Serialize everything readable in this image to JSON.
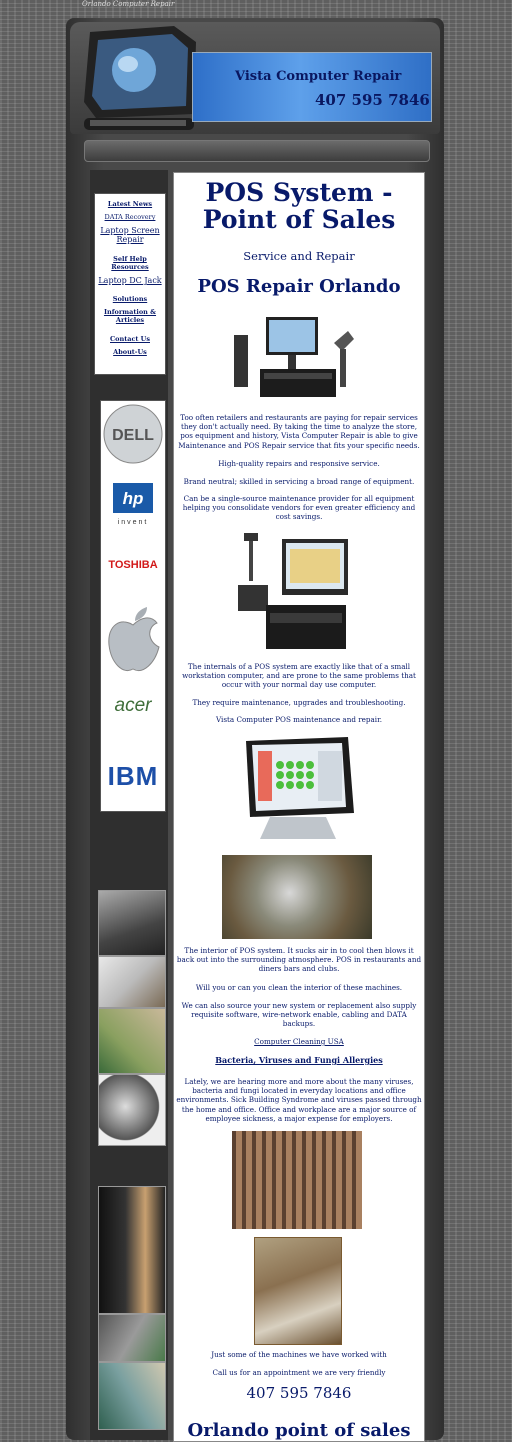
{
  "page": {
    "caption": "Orlando Computer Repair"
  },
  "banner": {
    "title": "Vista Computer Repair",
    "phone": "407 595 7846"
  },
  "nav": {
    "items": [
      {
        "label": "Latest News"
      },
      {
        "label": "DATA Recovery"
      },
      {
        "label": "Laptop Screen Repair"
      },
      {
        "label": "Self Help Resources"
      },
      {
        "label": "Laptop DC Jack"
      },
      {
        "label": "Solutions"
      },
      {
        "label": "Information & Articles"
      },
      {
        "label": "Contact Us"
      },
      {
        "label": "About-Us"
      }
    ]
  },
  "brands": {
    "dell": "DELL",
    "hp": "hp",
    "hp_sub": "invent",
    "toshiba": "TOSHIBA",
    "acer": "acer",
    "ibm": "IBM"
  },
  "content": {
    "title": "POS System - Point of Sales",
    "subtitle": "Service and Repair",
    "heading": "POS Repair Orlando",
    "p1": "Too often retailers and restaurants are paying for repair services they don't actually need. By taking the time to analyze the store, pos equipment and history, Vista Computer Repair is able to give Maintenance and POS Repair service that fits your specific needs.",
    "p2": "High-quality repairs and responsive service.",
    "p3": "Brand neutral; skilled in servicing a broad range of equipment.",
    "p4": "Can be a single-source maintenance provider for all equipment helping you consolidate vendors for even greater efficiency and cost savings.",
    "p5": "The internals of a POS system are exactly like that of a small workstation computer, and are prone to the same problems that occur with your normal day use computer.",
    "p6": "They require maintenance, upgrades and troubleshooting.",
    "p7": "Vista Computer POS maintenance and repair.",
    "p8": "The interior of POS system. It sucks air in to cool then blows it back out into the surrounding atmosphere. POS in restaurants and diners bars and clubs.",
    "p9": "Will you or can you clean the interior of these machines.",
    "p10": "We can also source your new system or replacement also supply requisite software, wire-network enable, cabling and DATA backups.",
    "link1": "Computer Cleaning USA",
    "link2": "Bacteria, Viruses and Fungi Allergies",
    "p11": "Lately, we are hearing more and more about the many viruses, bacteria and fungi located in everyday locations and office environments. Sick Building Syndrome and viruses passed through the home and office. Office and workplace are a major source of employee sickness, a major expense for employers.",
    "p12": "Just some of the machines we have worked with",
    "p13": "Call us for an appointment we are very friendly",
    "phone": "407 595 7846",
    "footer_heading": "Orlando point of sales"
  }
}
